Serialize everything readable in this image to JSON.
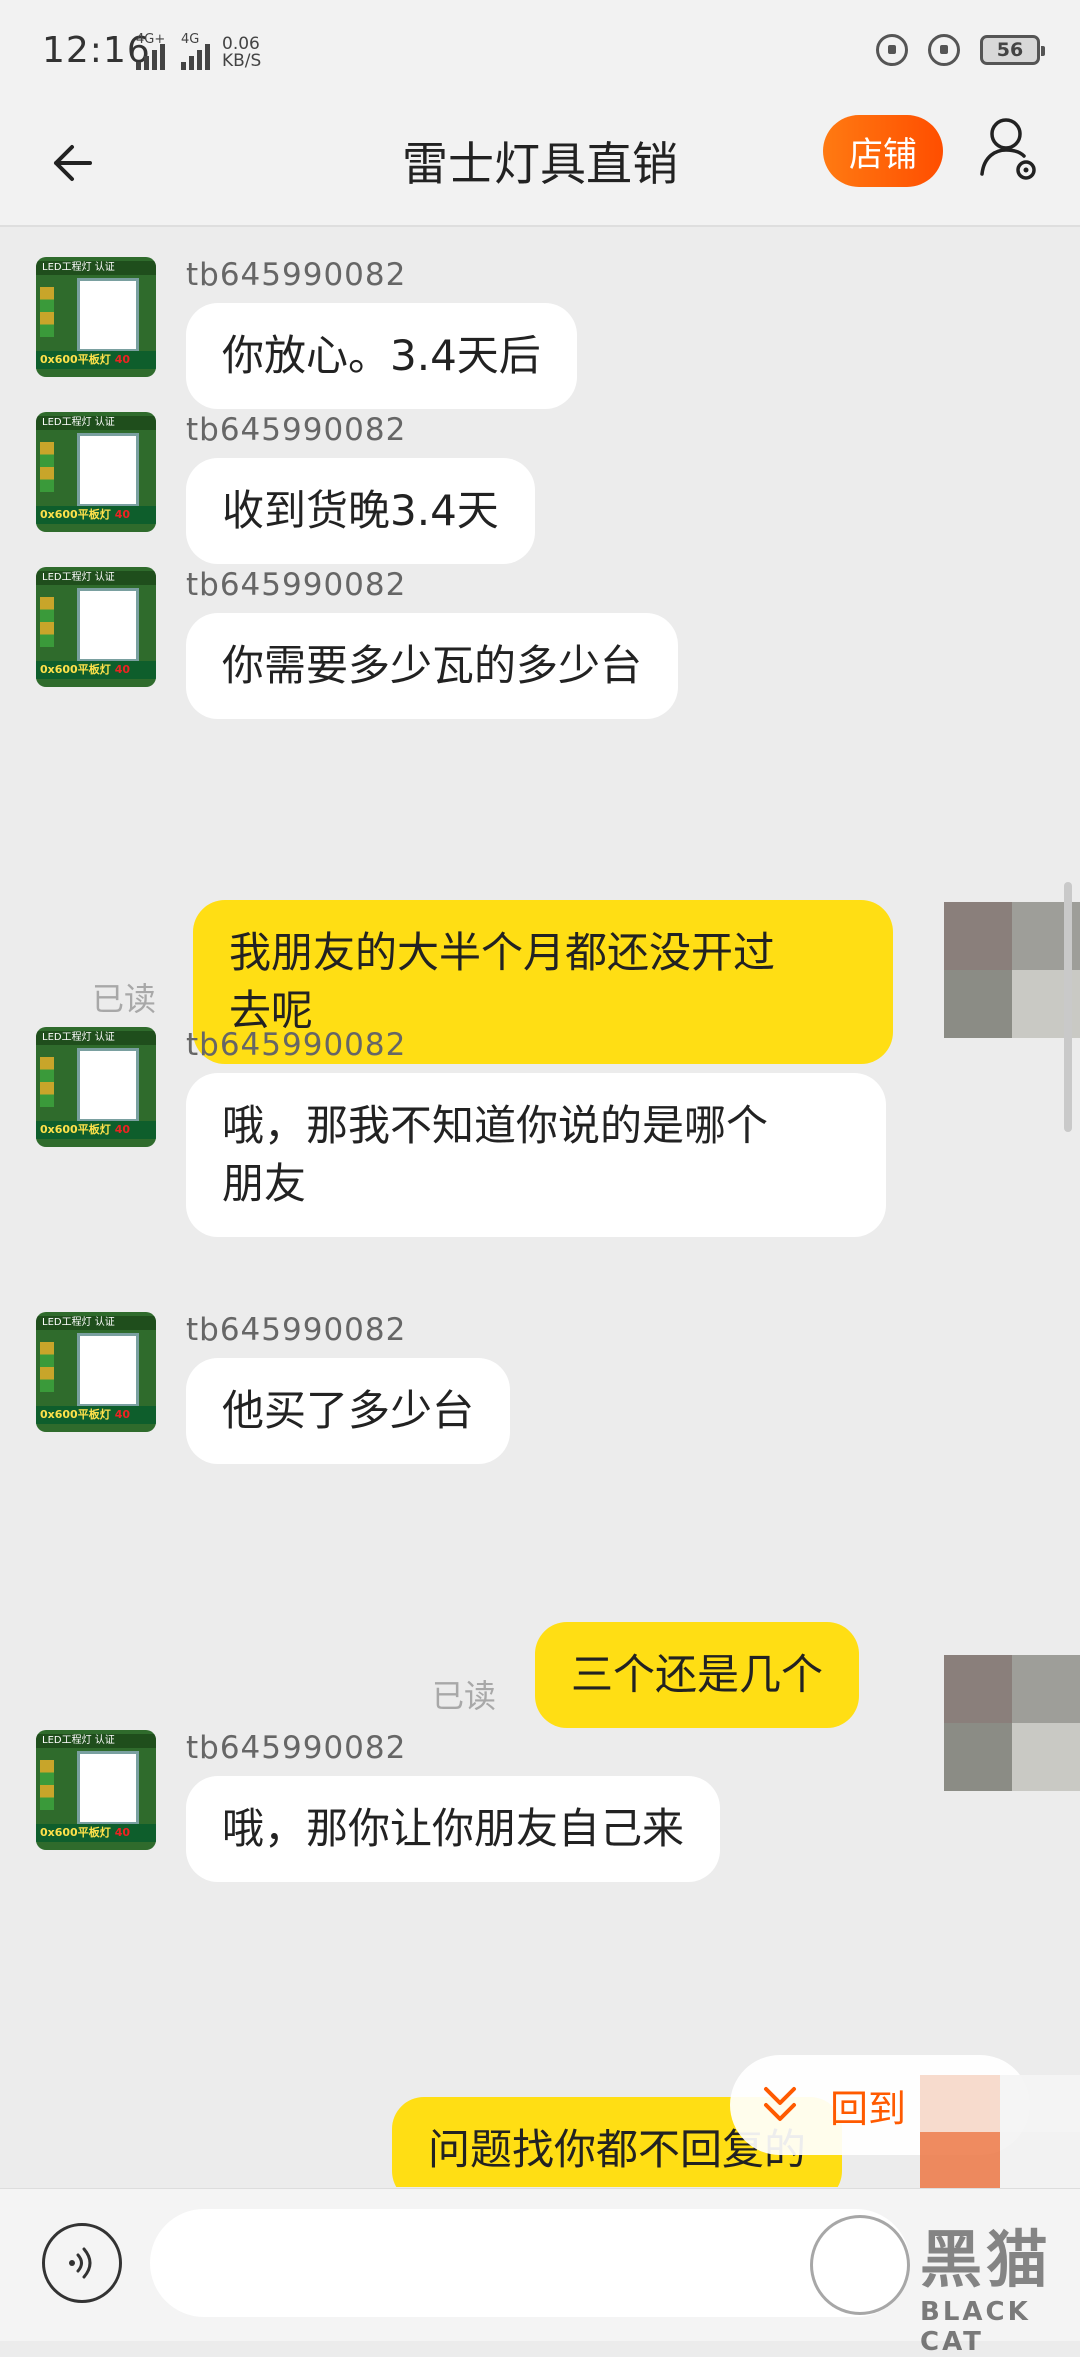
{
  "status_bar": {
    "time": "12:16",
    "signal1": "4G+",
    "signal2": "4G",
    "speed_value": "0.06",
    "speed_unit": "KB/S",
    "battery": "56"
  },
  "header": {
    "title": "雷士灯具直销",
    "shop_button": "店铺"
  },
  "shop_avatar": {
    "top_text": "LED工程灯 认证",
    "bottom_text": "0x600平板灯",
    "badge": "40"
  },
  "messages": [
    {
      "side": "in",
      "sender": "tb645990082",
      "lines": [
        "你放心。3.4天后"
      ]
    },
    {
      "side": "in",
      "sender": "tb645990082",
      "lines": [
        "收到货晚3.4天"
      ]
    },
    {
      "side": "in",
      "sender": "tb645990082",
      "lines": [
        "你需要多少瓦的多少台"
      ]
    },
    {
      "side": "out",
      "status": "已读",
      "lines": [
        "我朋友的大半个月都还没开过",
        "去呢"
      ]
    },
    {
      "side": "in",
      "sender": "tb645990082",
      "lines": [
        "哦，那我不知道你说的是哪个",
        "朋友"
      ]
    },
    {
      "side": "in",
      "sender": "tb645990082",
      "lines": [
        "他买了多少台"
      ]
    },
    {
      "side": "out",
      "status": "已读",
      "lines": [
        "三个还是几个"
      ]
    },
    {
      "side": "in",
      "sender": "tb645990082",
      "lines": [
        "哦，那你让你朋友自己来"
      ]
    },
    {
      "side": "out",
      "lines": [
        "问题找你都不回复的"
      ]
    }
  ],
  "scroll_to_bottom": {
    "label": "回到"
  },
  "input": {
    "value": "",
    "placeholder": ""
  },
  "watermark": {
    "text_cn": "黑猫",
    "text_en": "BLACK CAT"
  },
  "colors": {
    "incoming_bubble": "#ffffff",
    "outgoing_bubble": "#ffde14",
    "shop_button": "#ff5a00",
    "background": "#ececec"
  }
}
